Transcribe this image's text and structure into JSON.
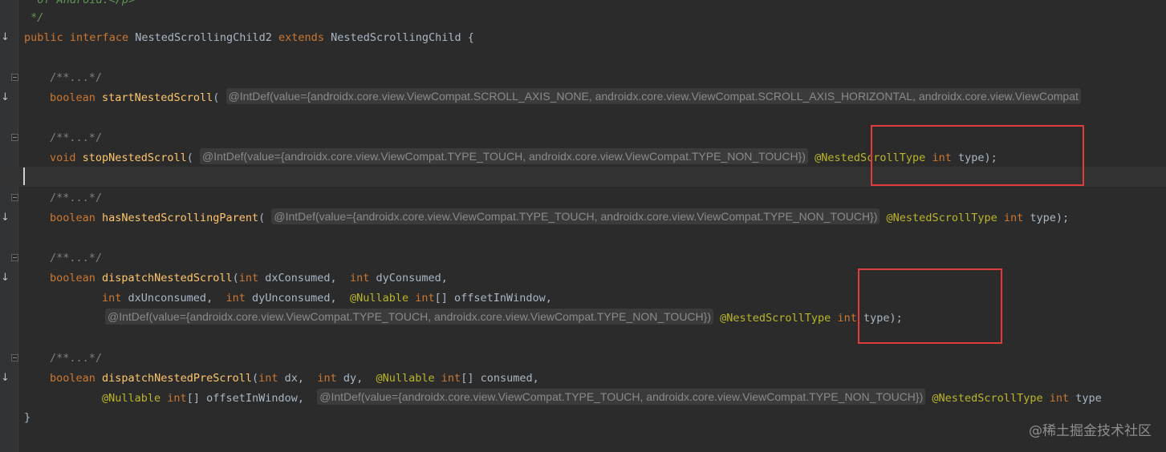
{
  "editor": {
    "top_fragment": "* of Android.</p>",
    "doc_end": " */",
    "decl": {
      "kw_public": "public",
      "kw_interface": "interface",
      "name": "NestedScrollingChild2",
      "kw_extends": "extends",
      "parent": "NestedScrollingChild",
      "open": "{"
    },
    "folded_comment": "/**...*/",
    "m1": {
      "ret": "boolean",
      "name": "startNestedScroll",
      "paren": "(",
      "hint": "@IntDef(value={androidx.core.view.ViewCompat.SCROLL_AXIS_NONE, androidx.core.view.ViewCompat.SCROLL_AXIS_HORIZONTAL, androidx.core.view.ViewCompat"
    },
    "m2": {
      "ret": "void",
      "name": "stopNestedScroll",
      "paren": "(",
      "hint": "@IntDef(value={androidx.core.view.ViewCompat.TYPE_TOUCH, androidx.core.view.ViewCompat.TYPE_NON_TOUCH})",
      "anno": "@NestedScrollType",
      "kw_int": "int",
      "tail": "type);"
    },
    "m3": {
      "ret": "boolean",
      "name": "hasNestedScrollingParent",
      "paren": "(",
      "hint": "@IntDef(value={androidx.core.view.ViewCompat.TYPE_TOUCH, androidx.core.view.ViewCompat.TYPE_NON_TOUCH})",
      "anno": "@NestedScrollType",
      "kw_int": "int",
      "tail": "type);"
    },
    "m4": {
      "ret": "boolean",
      "name": "dispatchNestedScroll",
      "paren": "(",
      "int1": "int",
      "p1": "dxConsumed,",
      "int2": "int",
      "p2": "dyConsumed,",
      "int3": "int",
      "p3": "dxUnconsumed,",
      "int4": "int",
      "p4": "dyUnconsumed,",
      "nullable": "@Nullable",
      "int5": "int",
      "p5": "[] offsetInWindow,",
      "hint": "@IntDef(value={androidx.core.view.ViewCompat.TYPE_TOUCH, androidx.core.view.ViewCompat.TYPE_NON_TOUCH})",
      "anno": "@NestedScrollType",
      "kw_int": "int",
      "tail": "type);"
    },
    "m5": {
      "ret": "boolean",
      "name": "dispatchNestedPreScroll",
      "paren": "(",
      "int1": "int",
      "p1": "dx,",
      "int2": "int",
      "p2": "dy,",
      "nullable1": "@Nullable",
      "int3": "int",
      "p3": "[] consumed,",
      "nullable2": "@Nullable",
      "int4": "int",
      "p4": "[] offsetInWindow,",
      "hint": "@IntDef(value={androidx.core.view.ViewCompat.TYPE_TOUCH, androidx.core.view.ViewCompat.TYPE_NON_TOUCH})",
      "anno": "@NestedScrollType",
      "kw_int": "int",
      "tail": "type"
    },
    "close": "}"
  },
  "watermark": "@稀土掘金技术社区",
  "colors": {
    "background": "#2b2b2b",
    "keyword": "#cc7832",
    "method": "#ffc66d",
    "annotation": "#bbb529",
    "highlight_box": "#e03c3c"
  }
}
